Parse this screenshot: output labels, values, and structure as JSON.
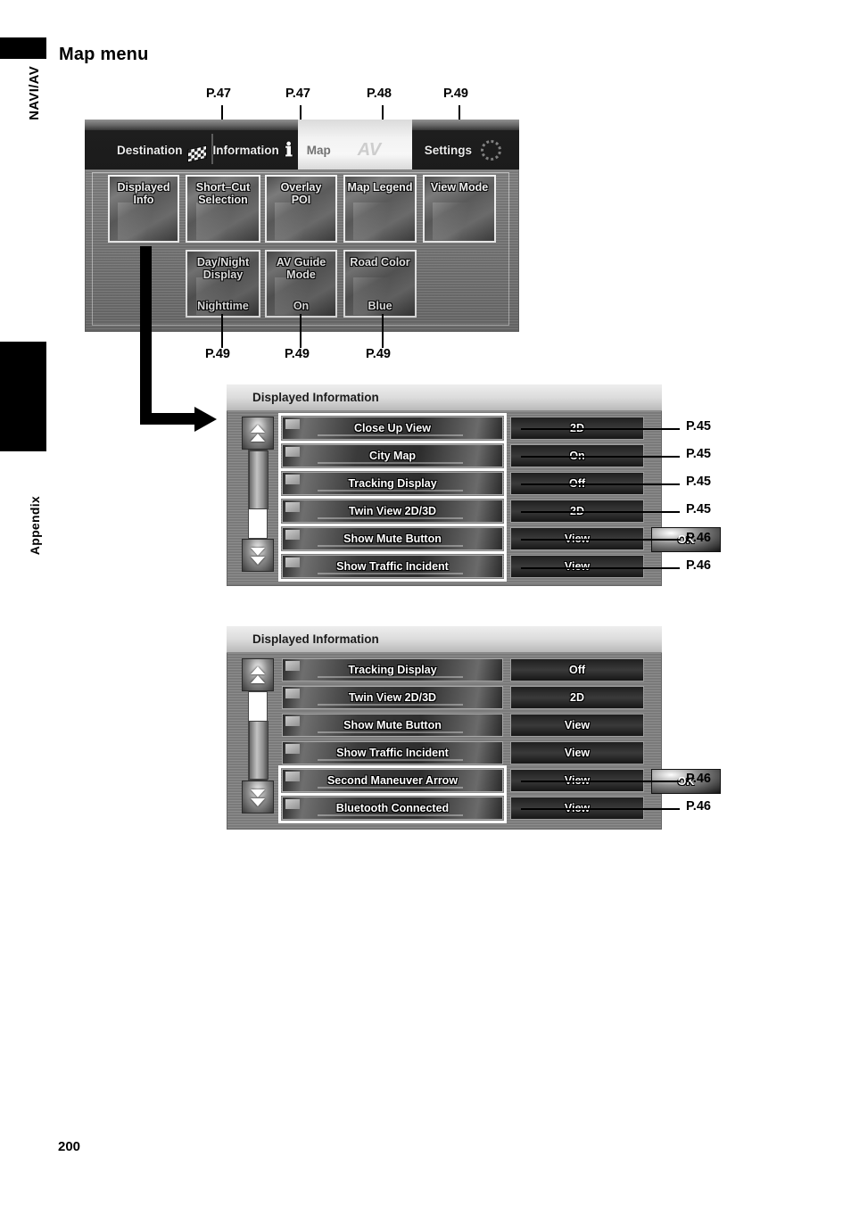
{
  "page": {
    "title": "Map menu",
    "number": "200",
    "edge_tabs": [
      {
        "label": "NAVI/AV"
      },
      {
        "label": "Appendix"
      }
    ]
  },
  "device_screen": {
    "tabs": [
      {
        "label": "Destination",
        "icon": "checkered-flag-icon",
        "active": false
      },
      {
        "label": "Information",
        "icon": "info-icon",
        "active": false
      },
      {
        "label": "Map",
        "icon": "av-icon",
        "active": true
      },
      {
        "label": "Settings",
        "icon": "gear-icon",
        "active": false
      }
    ],
    "menu_buttons": [
      {
        "title": "Displayed\nInfo",
        "line1": "Displayed",
        "line2": "Info",
        "value": ""
      },
      {
        "title": "Short-Cut Selection",
        "line1": "Short–Cut",
        "line2": "Selection",
        "value": ""
      },
      {
        "title": "Overlay POI",
        "line1": "Overlay",
        "line2": "POI",
        "value": ""
      },
      {
        "title": "Map Legend",
        "line1": "Map Legend",
        "line2": "",
        "value": ""
      },
      {
        "title": "View Mode",
        "line1": "View Mode",
        "line2": "",
        "value": ""
      },
      {
        "title": "Day/Night Display",
        "line1": "Day/Night",
        "line2": "Display",
        "value": "Nighttime"
      },
      {
        "title": "AV Guide Mode",
        "line1": "AV Guide",
        "line2": "Mode",
        "value": "On"
      },
      {
        "title": "Road Color",
        "line1": "Road Color",
        "line2": "",
        "value": "Blue"
      }
    ],
    "top_refs": [
      {
        "label": "P.47"
      },
      {
        "label": "P.47"
      },
      {
        "label": "P.48"
      },
      {
        "label": "P.49"
      }
    ],
    "bottom_refs": [
      {
        "label": "P.49"
      },
      {
        "label": "P.49"
      },
      {
        "label": "P.49"
      }
    ]
  },
  "dialog1": {
    "title": "Displayed Information",
    "ok_label": "OK",
    "rows": [
      {
        "name": "Close Up View",
        "value": "2D",
        "ref": "P.45",
        "highlight": true
      },
      {
        "name": "City Map",
        "value": "On",
        "ref": "P.45",
        "highlight": true
      },
      {
        "name": "Tracking Display",
        "value": "Off",
        "ref": "P.45",
        "highlight": true
      },
      {
        "name": "Twin View 2D/3D",
        "value": "2D",
        "ref": "P.45",
        "highlight": true
      },
      {
        "name": "Show Mute Button",
        "value": "View",
        "ref": "P.46",
        "highlight": true
      },
      {
        "name": "Show Traffic Incident",
        "value": "View",
        "ref": "P.46",
        "highlight": true
      }
    ]
  },
  "dialog2": {
    "title": "Displayed Information",
    "ok_label": "OK",
    "rows": [
      {
        "name": "Tracking Display",
        "value": "Off",
        "ref": "",
        "highlight": false
      },
      {
        "name": "Twin View 2D/3D",
        "value": "2D",
        "ref": "",
        "highlight": false
      },
      {
        "name": "Show Mute Button",
        "value": "View",
        "ref": "",
        "highlight": false
      },
      {
        "name": "Show Traffic Incident",
        "value": "View",
        "ref": "",
        "highlight": false
      },
      {
        "name": "Second Maneuver Arrow",
        "value": "View",
        "ref": "P.46",
        "highlight": true
      },
      {
        "name": "Bluetooth Connected",
        "value": "View",
        "ref": "P.46",
        "highlight": true
      }
    ]
  }
}
